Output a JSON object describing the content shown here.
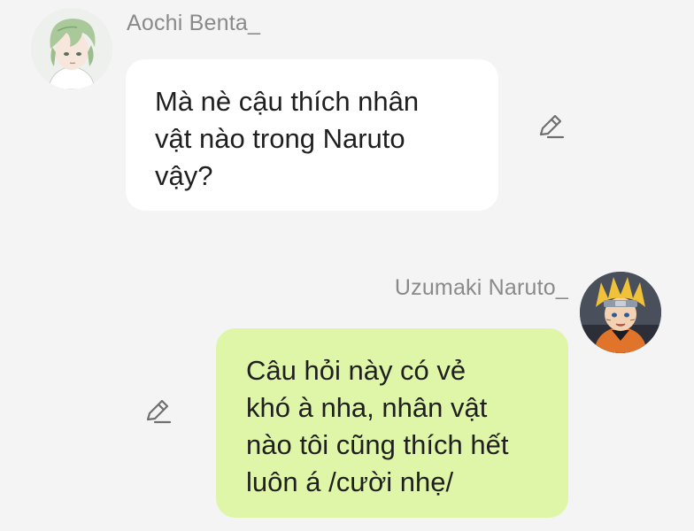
{
  "conversation": {
    "message_1": {
      "sender": "Aochi Benta_",
      "avatar_icon": "green-haired-character-avatar",
      "lines": [
        "Mà nè cậu thích nhân",
        "vật nào trong Naruto",
        "vậy?"
      ],
      "bubble_color": "#ffffff",
      "action_icon": "pencil-edit-icon"
    },
    "message_2": {
      "sender": "Uzumaki Naruto_",
      "avatar_icon": "naruto-character-avatar",
      "lines": [
        "Câu hỏi này có vẻ",
        "khó à nha, nhân vật",
        "nào tôi cũng thích hết",
        "luôn á /cười nhẹ/"
      ],
      "bubble_color": "#dff5a8",
      "action_icon": "pencil-edit-icon"
    }
  },
  "colors": {
    "background": "#f4f4f4",
    "name_text": "#8a8a8a",
    "message_text": "#1f1f1f"
  }
}
